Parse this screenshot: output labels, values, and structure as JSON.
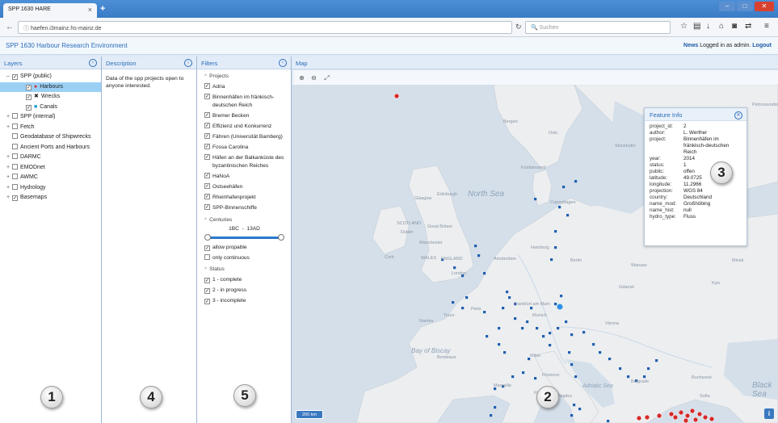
{
  "browser": {
    "tab_title": "SPP 1630 HARE",
    "tab_close": "×",
    "new_tab": "+",
    "url": "haefen.i3mainz.hs-mainz.de",
    "search_placeholder": "Suchen",
    "win_min": "–",
    "win_max": "□",
    "win_close": "✕"
  },
  "app": {
    "title": "SPP 1630 Harbour Research Environment",
    "news_link": "News",
    "logged_text": "Logged in as admin.",
    "logout_link": "Logout"
  },
  "layers": {
    "title": "Layers",
    "items": [
      {
        "label": "SPP (public)",
        "pm": "–",
        "checked": true
      },
      {
        "label": "Harbours",
        "checked": true,
        "marker": "●",
        "marker_color": "#d62b2b"
      },
      {
        "label": "Wrecks",
        "checked": true,
        "marker": "✖",
        "marker_color": "#222222"
      },
      {
        "label": "Canals",
        "checked": true,
        "marker": "■",
        "marker_color": "#1aa0d8"
      },
      {
        "label": "SPP (internal)",
        "pm": "+",
        "checked": false
      },
      {
        "label": "Fetch",
        "pm": "+",
        "checked": false
      },
      {
        "label": "Geodatabase of Shipwrecks",
        "checked": false
      },
      {
        "label": "Ancient Ports and Harbours",
        "checked": false
      },
      {
        "label": "DARMC",
        "pm": "+",
        "checked": false
      },
      {
        "label": "EMODnet",
        "pm": "+",
        "checked": false
      },
      {
        "label": "AWMC",
        "pm": "+",
        "checked": false
      },
      {
        "label": "Hydrology",
        "pm": "+",
        "checked": false
      },
      {
        "label": "Basemaps",
        "pm": "+",
        "checked": true
      }
    ]
  },
  "description": {
    "title": "Description",
    "text": "Data of the spp projects open to anyone interested."
  },
  "filters": {
    "title": "Filters",
    "projects_label": "Projects",
    "projects": [
      "Adria",
      "Binnenhäfen im fränkisch-deutschen Reich",
      "Bremer Becken",
      "Effizienz und Konkurrenz",
      "Fähren (Universität Bamberg)",
      "Fossa Carolina",
      "Häfen an der Balkanküste des byzantinischen Reiches",
      "HaNoA",
      "Ostseehäfen",
      "Rheinhafenprojekt",
      "SPP-Binnenschiffe"
    ],
    "centuries_label": "Centuries",
    "centuries_range": "1BC  -  13AD",
    "allow_propable": "allow propable",
    "only_continuous": "only continuous",
    "status_label": "Status",
    "status": [
      "1 - complete",
      "2 - in progress",
      "3 - incomplete"
    ]
  },
  "map": {
    "title": "Map",
    "scale": "200 km",
    "info_button": "i",
    "sea_labels": [
      "North Sea",
      "Bay of Biscay",
      "Black Sea",
      "Adriatic Sea"
    ],
    "place_labels": [
      "Bergen",
      "Oslo",
      "Stockholm",
      "Kristiansand",
      "Copenhagen",
      "Glasgow",
      "Edinburgh",
      "SCOTLAND",
      "Great Britain",
      "Manchester",
      "WALES",
      "ENGLAND",
      "London",
      "Amsterdam",
      "Hamburg",
      "Berlin",
      "Gdansk",
      "Warsaw",
      "Kyiv",
      "Paris",
      "Frankfurt am Main",
      "Munich",
      "Vienna",
      "Milan",
      "Florence",
      "Rome",
      "Bordeaux",
      "Marseille",
      "Naples",
      "Bucharest",
      "Sofia",
      "Belgrade",
      "Minsk",
      "Riga",
      "Petrozavodsk",
      "Cork",
      "Dublin",
      "Tours",
      "Nantes"
    ]
  },
  "feature_info": {
    "title": "Feature Info",
    "fields": [
      {
        "k": "project_id:",
        "v": "2"
      },
      {
        "k": "author:",
        "v": "L. Werther"
      },
      {
        "k": "project:",
        "v": "Binnenhäfen im fränkisch-deutschen Reich"
      },
      {
        "k": "year:",
        "v": "2014"
      },
      {
        "k": "status:",
        "v": "1"
      },
      {
        "k": "public:",
        "v": "offen"
      },
      {
        "k": "latitude:",
        "v": "49.0725"
      },
      {
        "k": "longitude:",
        "v": "11.2966"
      },
      {
        "k": "projection:",
        "v": "WGS 84"
      },
      {
        "k": "country:",
        "v": "Deutschland"
      },
      {
        "k": "name_mod:",
        "v": "Großhöbing"
      },
      {
        "k": "name_hist:",
        "v": "null"
      },
      {
        "k": "hydro_type:",
        "v": "Fluss"
      }
    ]
  },
  "badges": {
    "b1": "1",
    "b2": "2",
    "b3": "3",
    "b4": "4",
    "b5": "5"
  },
  "icons": {
    "collapse": "‹",
    "check": "✓",
    "chevron_up": "^"
  }
}
